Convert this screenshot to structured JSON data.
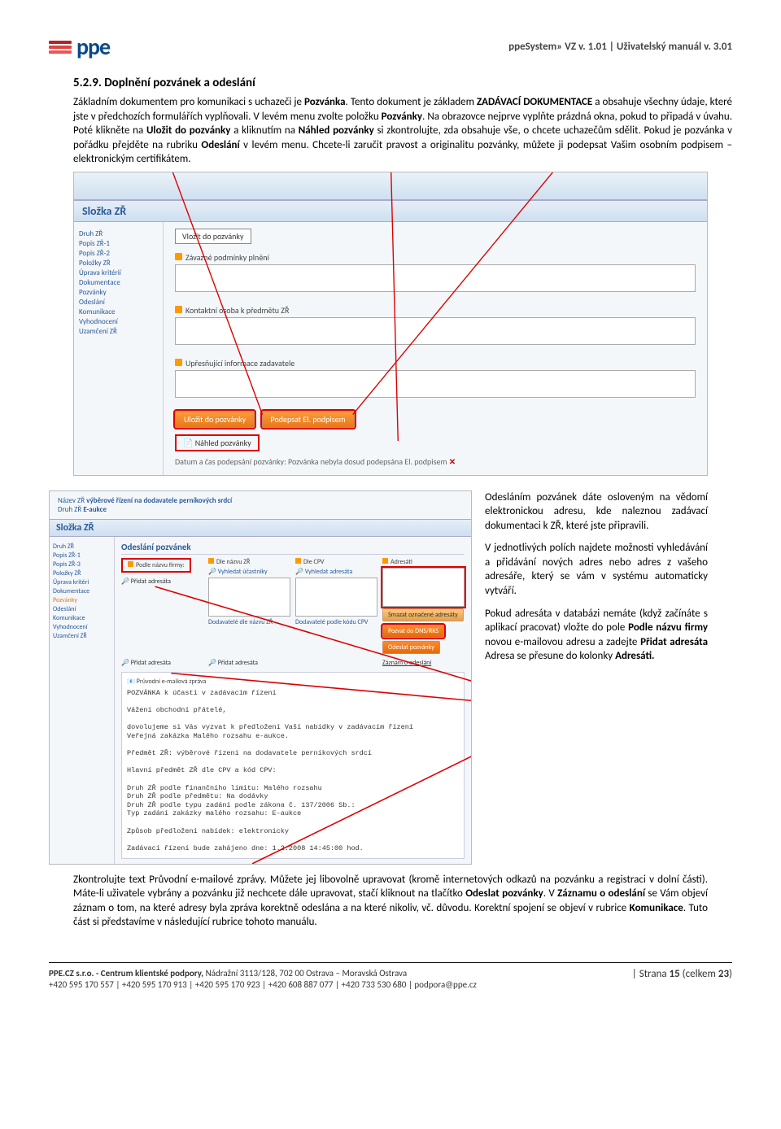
{
  "header": {
    "logo_text": "ppe",
    "right": "ppeSystem» VZ v. 1.01 | Uživatelský manuál v. 3.01"
  },
  "section": {
    "heading": "5.2.9. Doplnění pozvánek a odeslání",
    "para1_a": "Základním dokumentem pro komunikaci s uchazeči je ",
    "para1_b": "Pozvánka",
    "para1_c": ". Tento dokument je základem ",
    "para1_d": "ZADÁVACÍ DOKUMENTACE",
    "para1_e": " a obsahuje všechny údaje, které jste v předchozích formulářích vyplňovali. V levém menu zvolte položku ",
    "para1_f": "Pozvánky",
    "para1_g": ". Na obrazovce nejprve vyplňte prázdná okna, pokud to připadá v úvahu. Poté klikněte na ",
    "para1_h": "Uložit do pozvánky",
    "para1_i": " a kliknutím na ",
    "para1_j": "Náhled pozvánky",
    "para1_k": " si zkontrolujte, zda obsahuje vše, o chcete uchazečům sdělit. Pokud je pozvánka v pořádku přejděte na rubriku ",
    "para1_l": "Odeslání",
    "para1_m": " v levém menu. Chcete-li zaručit pravost a originalitu pozvánky, můžete ji podepsat Vašim osobním podpisem – elektronickým certifikátem."
  },
  "shot1": {
    "section_title": "Složka ZŘ",
    "menu": [
      "Druh ZŘ",
      "Popis ZŘ-1",
      "Popis ZŘ-2",
      "Položky ZŘ",
      "Úprava kritérií",
      "Dokumentace",
      "Pozvánky",
      "Odeslání",
      "Komunikace",
      "Vyhodnocení",
      "Uzamčení ZŘ"
    ],
    "vlozit": "Vložit do pozvánky",
    "f1": "Závazné podmínky plnění",
    "f2": "Kontaktní osoba k předmětu ZŘ",
    "f3": "Upřesňující informace zadavatele",
    "btn1": "Uložit do pozvánky",
    "btn2": "Podepsat El. podpisem",
    "nahled": "Náhled pozvánky",
    "sig": "Datum a čas podepsání pozvánky: Pozvánka nebyla dosud podepsána El. podpisem",
    "x": "✕"
  },
  "shot2": {
    "title_a": "Název ZŘ ",
    "title_b": "výběrové řízení na dodavatele perníkových srdcí",
    "title_c": "Druh ZŘ ",
    "title_d": "E-aukce",
    "section_title": "Složka ZŘ",
    "menu": [
      "Druh ZŘ",
      "Popis ZŘ-1",
      "Popis ZŘ-3",
      "Položky ZŘ",
      "Úprava kritéri",
      "Dokumentace",
      "Pozvánky",
      "Odeslání",
      "Komunikace",
      "Vyhodnocení",
      "Uzamčení ZŘ"
    ],
    "ods": "Odeslání pozvánek",
    "col1": "Podle názvu firmy:",
    "col2": "Dle názvu ZŘ",
    "col3": "Dle CPV",
    "col4": "Adresáti",
    "addradr": "Přidat adresáta",
    "s1": "Vyhledat účastníky",
    "s2": "Dodavatelé dle názvu ZŘ",
    "s3": "Vyhledat adresáta",
    "s4": "Dodavatelé podle kódu CPV",
    "smaz": "Smazat označené adresáty",
    "pozvat": "Pozvat do DNS/RKS",
    "odeslat": "Odeslat pozvánky",
    "pridat2": "Přidat adresáta",
    "pridat3": "Přidat adresáta",
    "zaznam": "Záznam o odeslání",
    "mail_label": "Průvodní e-mailová zpráva",
    "mail_l1": "POZVÁNKA k účasti v zadávacím řízení",
    "mail_l2": "Vážení obchodní přátelé,",
    "mail_l3": "dovolujeme si Vás vyzvat k předložení Vaší nabídky v zadávacím řízení",
    "mail_l4": "Veřejná zakázka Malého rozsahu e-aukce.",
    "mail_l5": "Předmět ZŘ: výběrové řízení na dodavatele perníkových srdcí",
    "mail_l6": "Hlavní předmět ZŘ dle CPV a kód CPV:",
    "mail_l7": "Druh ZŘ podle finančního limitu: Malého rozsahu",
    "mail_l8": "Druh ZŘ podle předmětu: Na dodávky",
    "mail_l9": "Druh ZŘ podle typu zadání podle zákona č. 137/2006 Sb.:",
    "mail_l10": "Typ zadání zakázky malého rozsahu: E-aukce",
    "mail_l11": "Způsob předložení nabídek: elektronicky",
    "mail_l12": "Zadávací řízení bude zahájeno dne: 1.2.2008 14:45:00 hod."
  },
  "side": {
    "p1": "Odesláním pozvánek dáte osloveným na vědomí elektronickou adresu, kde naleznou zadávací dokumentaci k ZŘ, které jste připravili.",
    "p2": "V jednotlivých polích najdete možnosti vyhledávání a přidávání nových adres nebo adres z vašeho adresáře, který se vám v systému automaticky vytváří.",
    "p3_a": "Pokud adresáta v databázi nemáte (když začínáte s aplikací pracovat) vložte do pole ",
    "p3_b": "Podle názvu firmy",
    "p3_c": " novou e-mailovou adresu a zadejte ",
    "p3_d": "Přidat adresáta",
    "p3_e": " Adresa se přesune do kolonky ",
    "p3_f": "Adresáti.",
    "p3_g": ""
  },
  "final": {
    "a": "Zkontrolujte text Průvodní e-mailové zprávy. Můžete jej libovolně upravovat (kromě internetových odkazů na pozvánku a registraci v dolní části). Máte-li uživatele vybrány a pozvánku již nechcete dále upravovat, stačí kliknout na tlačítko ",
    "b": "Odeslat pozvánky",
    "c": ". V ",
    "d": "Záznamu o odeslání",
    "e": " se Vám objeví záznam o tom, na které adresy byla zpráva korektně odeslána a na které nikoliv, vč. důvodu. Korektní spojení se objeví v rubrice ",
    "f": "Komunikace",
    "g": ". Tuto část si představíme v následující rubrice tohoto manuálu."
  },
  "footer": {
    "l1_a": "PPE.CZ s.r.o. - Centrum klientské podpory, ",
    "l1_b": "Nádražní 3113/128, 702 00 Ostrava – Moravská Ostrava",
    "l2": "+420 595 170 557 | +420 595 170 913 | +420 595 170 923 | +420 608 887 077 | +420 733 530 680 | podpora@ppe.cz",
    "r_a": "| Strana ",
    "r_b": "15 ",
    "r_c": "(celkem ",
    "r_d": "23",
    "r_e": ")"
  }
}
